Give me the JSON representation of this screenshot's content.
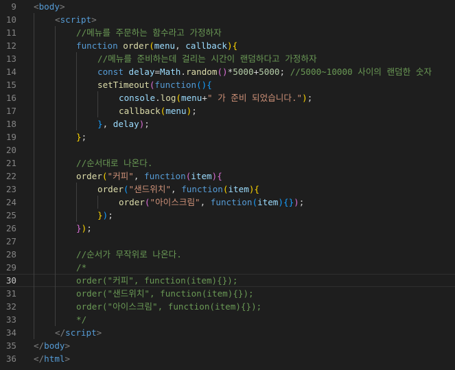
{
  "editor": {
    "theme": "dark",
    "active_line": 30,
    "colors": {
      "background": "#1e1e1e",
      "line_number": "#858585",
      "active_line_number": "#c6c6c6",
      "tag": "#569cd6",
      "punctuation": "#808080",
      "comment": "#6a9955",
      "function": "#dcdcaa",
      "parameter": "#9cdcfe",
      "string": "#ce9178",
      "number": "#b5cea8",
      "bracket_level_1": "#ffd700",
      "bracket_level_2": "#da70d6",
      "bracket_level_3": "#179fff"
    },
    "lines": [
      {
        "num": "9",
        "indent": 0,
        "tokens": [
          [
            "tok-punct",
            "<"
          ],
          [
            "tok-tag",
            "body"
          ],
          [
            "tok-punct",
            ">"
          ]
        ]
      },
      {
        "num": "10",
        "indent": 1,
        "tokens": [
          [
            "tok-punct",
            "<"
          ],
          [
            "tok-tag",
            "script"
          ],
          [
            "tok-punct",
            ">"
          ]
        ]
      },
      {
        "num": "11",
        "indent": 2,
        "tokens": [
          [
            "tok-comment",
            "//메뉴를 주문하는 함수라고 가정하자"
          ]
        ]
      },
      {
        "num": "12",
        "indent": 2,
        "tokens": [
          [
            "tok-keyword",
            "function"
          ],
          [
            "tok-text",
            " "
          ],
          [
            "tok-function",
            "order"
          ],
          [
            "tok-bracket1",
            "("
          ],
          [
            "tok-param",
            "menu"
          ],
          [
            "tok-text",
            ", "
          ],
          [
            "tok-param",
            "callback"
          ],
          [
            "tok-bracket1",
            ")"
          ],
          [
            "tok-bracket1",
            "{"
          ]
        ]
      },
      {
        "num": "13",
        "indent": 3,
        "tokens": [
          [
            "tok-comment",
            "//메뉴를 준비하는데 걸리는 시간이 랜덤하다고 가정하자"
          ]
        ]
      },
      {
        "num": "14",
        "indent": 3,
        "tokens": [
          [
            "tok-keyword",
            "const"
          ],
          [
            "tok-text",
            " "
          ],
          [
            "tok-param",
            "delay"
          ],
          [
            "tok-text",
            "="
          ],
          [
            "tok-param",
            "Math"
          ],
          [
            "tok-text",
            "."
          ],
          [
            "tok-function",
            "random"
          ],
          [
            "tok-bracket2",
            "()"
          ],
          [
            "tok-text",
            "*"
          ],
          [
            "tok-number",
            "5000"
          ],
          [
            "tok-text",
            "+"
          ],
          [
            "tok-number",
            "5000"
          ],
          [
            "tok-text",
            "; "
          ],
          [
            "tok-comment",
            "//5000~10000 사이의 랜덤한 숫자"
          ]
        ]
      },
      {
        "num": "15",
        "indent": 3,
        "tokens": [
          [
            "tok-function",
            "setTimeout"
          ],
          [
            "tok-bracket2",
            "("
          ],
          [
            "tok-keyword",
            "function"
          ],
          [
            "tok-bracket3",
            "()"
          ],
          [
            "tok-bracket3",
            "{"
          ]
        ]
      },
      {
        "num": "16",
        "indent": 4,
        "tokens": [
          [
            "tok-param",
            "console"
          ],
          [
            "tok-text",
            "."
          ],
          [
            "tok-function",
            "log"
          ],
          [
            "tok-bracket1",
            "("
          ],
          [
            "tok-param",
            "menu"
          ],
          [
            "tok-text",
            "+"
          ],
          [
            "tok-string",
            "\" 가 준비 되었습니다.\""
          ],
          [
            "tok-bracket1",
            ")"
          ],
          [
            "tok-text",
            ";"
          ]
        ]
      },
      {
        "num": "17",
        "indent": 4,
        "tokens": [
          [
            "tok-function",
            "callback"
          ],
          [
            "tok-bracket1",
            "("
          ],
          [
            "tok-param",
            "menu"
          ],
          [
            "tok-bracket1",
            ")"
          ],
          [
            "tok-text",
            ";"
          ]
        ]
      },
      {
        "num": "18",
        "indent": 3,
        "tokens": [
          [
            "tok-bracket3",
            "}"
          ],
          [
            "tok-text",
            ", "
          ],
          [
            "tok-param",
            "delay"
          ],
          [
            "tok-bracket2",
            ")"
          ],
          [
            "tok-text",
            ";"
          ]
        ]
      },
      {
        "num": "19",
        "indent": 2,
        "tokens": [
          [
            "tok-bracket1",
            "}"
          ],
          [
            "tok-text",
            ";"
          ]
        ]
      },
      {
        "num": "20",
        "indent": 2,
        "tokens": []
      },
      {
        "num": "21",
        "indent": 2,
        "tokens": [
          [
            "tok-comment",
            "//순서대로 나온다."
          ]
        ]
      },
      {
        "num": "22",
        "indent": 2,
        "tokens": [
          [
            "tok-function",
            "order"
          ],
          [
            "tok-bracket1",
            "("
          ],
          [
            "tok-string",
            "\"커피\""
          ],
          [
            "tok-text",
            ", "
          ],
          [
            "tok-keyword",
            "function"
          ],
          [
            "tok-bracket2",
            "("
          ],
          [
            "tok-param",
            "item"
          ],
          [
            "tok-bracket2",
            ")"
          ],
          [
            "tok-bracket2",
            "{"
          ]
        ]
      },
      {
        "num": "23",
        "indent": 3,
        "tokens": [
          [
            "tok-function",
            "order"
          ],
          [
            "tok-bracket3",
            "("
          ],
          [
            "tok-string",
            "\"샌드위치\""
          ],
          [
            "tok-text",
            ", "
          ],
          [
            "tok-keyword",
            "function"
          ],
          [
            "tok-bracket1",
            "("
          ],
          [
            "tok-param",
            "item"
          ],
          [
            "tok-bracket1",
            ")"
          ],
          [
            "tok-bracket1",
            "{"
          ]
        ]
      },
      {
        "num": "24",
        "indent": 4,
        "tokens": [
          [
            "tok-function",
            "order"
          ],
          [
            "tok-bracket2",
            "("
          ],
          [
            "tok-string",
            "\"아이스크림\""
          ],
          [
            "tok-text",
            ", "
          ],
          [
            "tok-keyword",
            "function"
          ],
          [
            "tok-bracket3",
            "("
          ],
          [
            "tok-param",
            "item"
          ],
          [
            "tok-bracket3",
            ")"
          ],
          [
            "tok-bracket3",
            "{}"
          ],
          [
            "tok-bracket2",
            ")"
          ],
          [
            "tok-text",
            ";"
          ]
        ]
      },
      {
        "num": "25",
        "indent": 3,
        "tokens": [
          [
            "tok-bracket1",
            "}"
          ],
          [
            "tok-bracket3",
            ")"
          ],
          [
            "tok-text",
            ";"
          ]
        ]
      },
      {
        "num": "26",
        "indent": 2,
        "tokens": [
          [
            "tok-bracket2",
            "}"
          ],
          [
            "tok-bracket1",
            ")"
          ],
          [
            "tok-text",
            ";"
          ]
        ]
      },
      {
        "num": "27",
        "indent": 2,
        "tokens": []
      },
      {
        "num": "28",
        "indent": 2,
        "tokens": [
          [
            "tok-comment",
            "//순서가 무작위로 나온다."
          ]
        ]
      },
      {
        "num": "29",
        "indent": 2,
        "tokens": [
          [
            "tok-comment",
            "/*"
          ]
        ]
      },
      {
        "num": "30",
        "indent": 2,
        "tokens": [
          [
            "tok-comment",
            "order(\"커피\", function(item){});"
          ]
        ]
      },
      {
        "num": "31",
        "indent": 2,
        "tokens": [
          [
            "tok-comment",
            "order(\"샌드위치\", function(item){});"
          ]
        ]
      },
      {
        "num": "32",
        "indent": 2,
        "tokens": [
          [
            "tok-comment",
            "order(\"아이스크림\", function(item){});"
          ]
        ]
      },
      {
        "num": "33",
        "indent": 2,
        "tokens": [
          [
            "tok-comment",
            "*/"
          ]
        ]
      },
      {
        "num": "34",
        "indent": 1,
        "tokens": [
          [
            "tok-punct",
            "</"
          ],
          [
            "tok-tag",
            "script"
          ],
          [
            "tok-punct",
            ">"
          ]
        ]
      },
      {
        "num": "35",
        "indent": 0,
        "tokens": [
          [
            "tok-punct",
            "</"
          ],
          [
            "tok-tag",
            "body"
          ],
          [
            "tok-punct",
            ">"
          ]
        ]
      },
      {
        "num": "36",
        "indent": 0,
        "tokens": [
          [
            "tok-punct",
            "</"
          ],
          [
            "tok-tag",
            "html"
          ],
          [
            "tok-punct",
            ">"
          ]
        ]
      }
    ]
  }
}
